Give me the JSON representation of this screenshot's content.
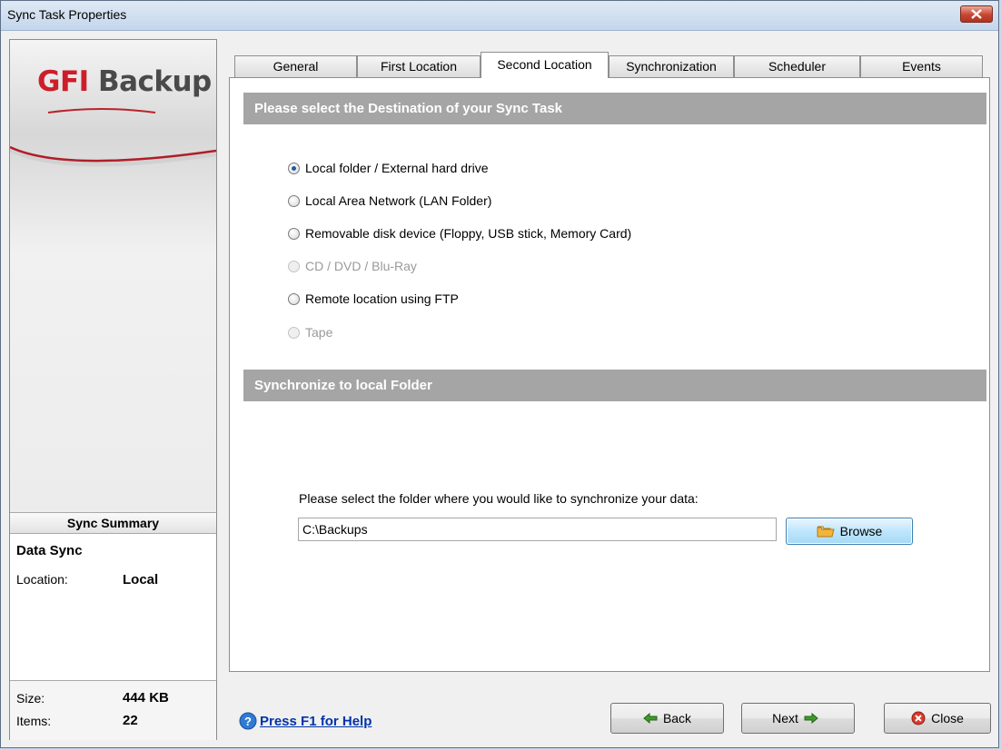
{
  "window": {
    "title": "Sync Task Properties"
  },
  "logo": {
    "part1": "GFI",
    "part2": "Backup"
  },
  "tabs": [
    {
      "label": "General"
    },
    {
      "label": "First Location"
    },
    {
      "label": "Second Location"
    },
    {
      "label": "Synchronization"
    },
    {
      "label": "Scheduler"
    },
    {
      "label": "Events"
    }
  ],
  "destination": {
    "header": "Please select the Destination of your Sync Task",
    "options": [
      {
        "label": "Local folder / External hard drive",
        "selected": true,
        "enabled": true
      },
      {
        "label": "Local Area Network (LAN Folder)",
        "selected": false,
        "enabled": true
      },
      {
        "label": "Removable disk device (Floppy, USB stick, Memory Card)",
        "selected": false,
        "enabled": true
      },
      {
        "label": "CD / DVD / Blu-Ray",
        "selected": false,
        "enabled": false
      },
      {
        "label": "Remote location using FTP",
        "selected": false,
        "enabled": true
      },
      {
        "label": "Tape",
        "selected": false,
        "enabled": false
      }
    ]
  },
  "local_folder": {
    "header": "Synchronize to local Folder",
    "prompt": "Please select the folder where you would like to synchronize your data:",
    "path": "C:\\Backups",
    "browse_label": "Browse"
  },
  "summary": {
    "title": "Sync Summary",
    "name": "Data Sync",
    "location_label": "Location:",
    "location_value": "Local",
    "size_label": "Size:",
    "size_value": "444 KB",
    "items_label": "Items:",
    "items_value": "22"
  },
  "footer": {
    "help": "Press F1 for Help",
    "back": "Back",
    "next": "Next",
    "close": "Close"
  }
}
